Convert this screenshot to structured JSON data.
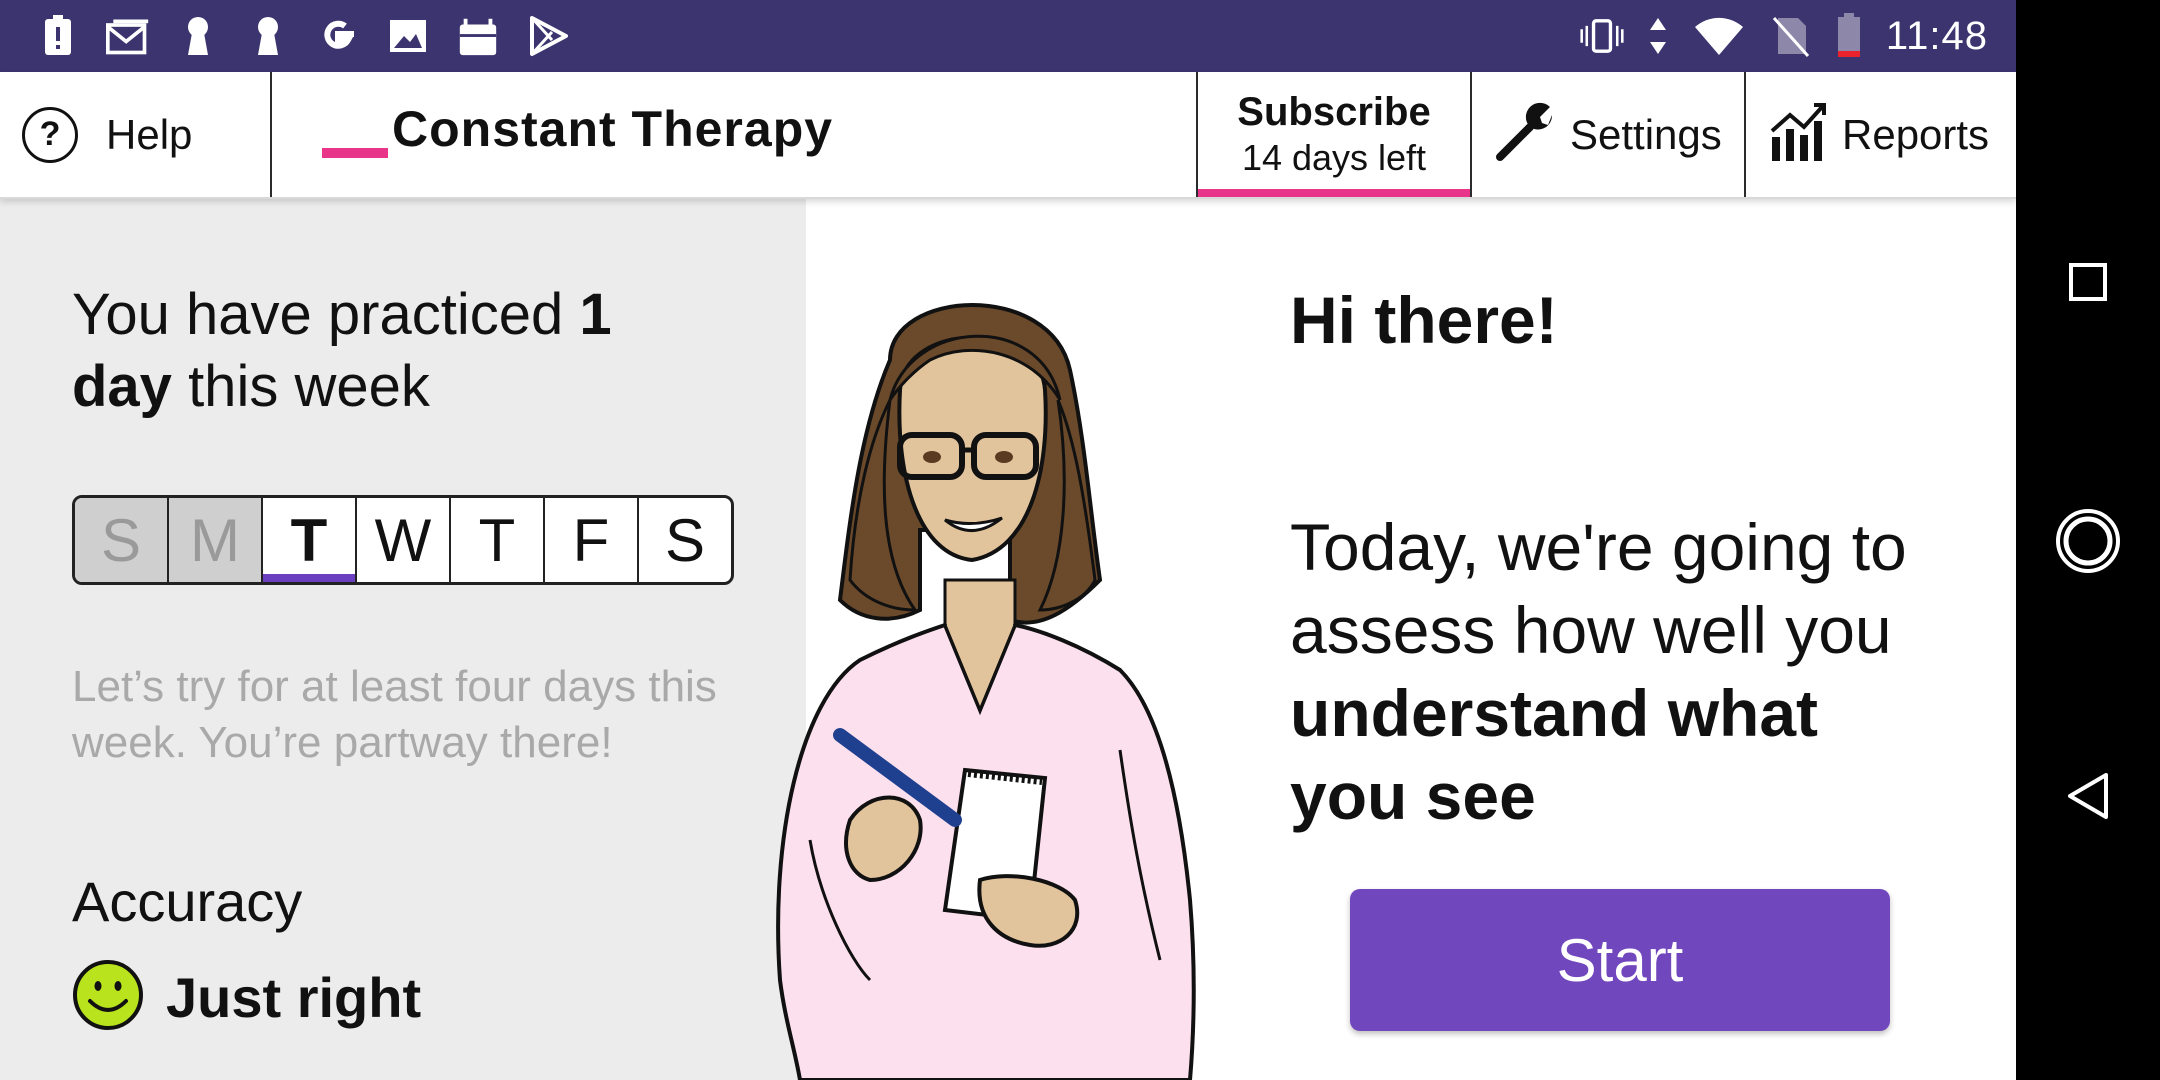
{
  "status_bar": {
    "time": "11:48",
    "left_icons": [
      "alert-icon",
      "gmail-icon",
      "keyhole-icon",
      "keyhole-icon",
      "google-icon",
      "image-icon",
      "android-icon",
      "play-icon"
    ],
    "right_icons": [
      "vibrate-icon",
      "data-arrows-icon",
      "wifi-icon",
      "no-sim-icon",
      "battery-low-icon"
    ]
  },
  "app_bar": {
    "help_label": "Help",
    "help_glyph": "?",
    "brand_title": "Constant Therapy",
    "subscribe_label": "Subscribe",
    "subscribe_sub": "14 days left",
    "settings_label": "Settings",
    "reports_label": "Reports"
  },
  "practice": {
    "prefix": "You have practiced ",
    "count_bold": "1 day",
    "suffix": " this week"
  },
  "week": {
    "days": [
      {
        "label": "S",
        "state": "past"
      },
      {
        "label": "M",
        "state": "past"
      },
      {
        "label": "T",
        "state": "today"
      },
      {
        "label": "W",
        "state": "upcoming"
      },
      {
        "label": "T",
        "state": "upcoming"
      },
      {
        "label": "F",
        "state": "upcoming"
      },
      {
        "label": "S",
        "state": "upcoming"
      }
    ]
  },
  "encouragement": "Let’s try for at least four days this week. You’re partway there!",
  "accuracy": {
    "label": "Accuracy",
    "value": "Just right"
  },
  "main": {
    "greeting": "Hi there!",
    "message_part1": "Today, we're going to assess how well you ",
    "message_bold": "understand what you see",
    "start_label": "Start"
  },
  "colors": {
    "status_bar": "#3b346f",
    "accent_pink": "#e8358a",
    "accent_purple": "#7047bd",
    "smiley": "#b9e31c"
  }
}
